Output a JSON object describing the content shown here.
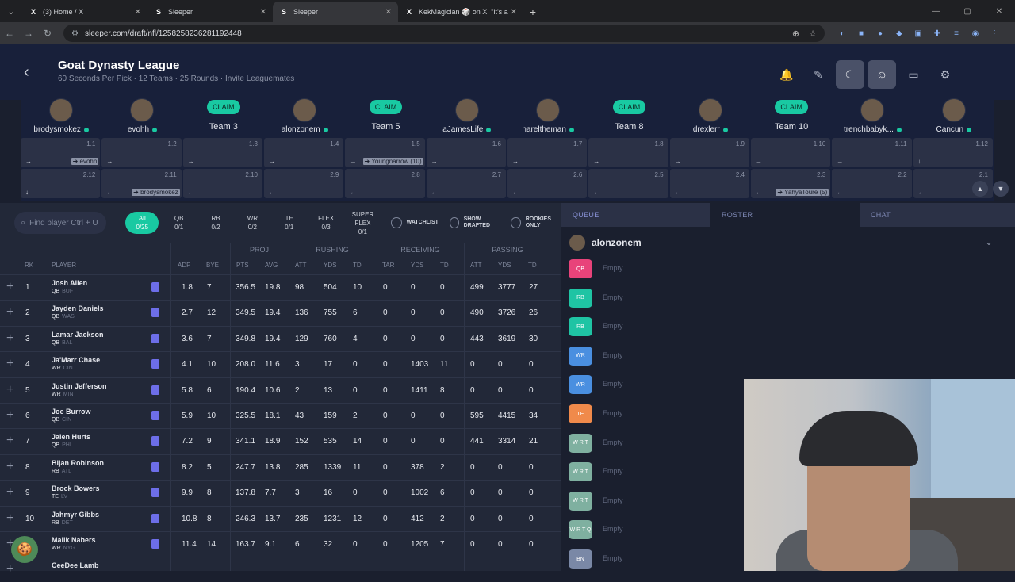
{
  "browser": {
    "tabs": [
      {
        "title": "(3) Home / X",
        "favicon": "X"
      },
      {
        "title": "Sleeper",
        "favicon": "S"
      },
      {
        "title": "Sleeper",
        "favicon": "S",
        "active": true
      },
      {
        "title": "KekMagician 🎲 on X: \"it's a",
        "favicon": "X"
      }
    ],
    "url": "sleeper.com/draft/nfl/1258258236281192448"
  },
  "header": {
    "league_name": "Goat Dynasty League",
    "league_sub": "60 Seconds Per Pick · 12 Teams · 25 Rounds · Invite Leaguemates"
  },
  "teams": [
    {
      "name": "brodysmokez",
      "claim": false,
      "online": true
    },
    {
      "name": "evohh",
      "claim": false,
      "online": true
    },
    {
      "name": "Team 3",
      "claim": true,
      "online": false
    },
    {
      "name": "alonzonem",
      "claim": false,
      "online": true
    },
    {
      "name": "Team 5",
      "claim": true,
      "online": false
    },
    {
      "name": "aJamesLife",
      "claim": false,
      "online": true
    },
    {
      "name": "hareltheman",
      "claim": false,
      "online": true
    },
    {
      "name": "Team 8",
      "claim": true,
      "online": false
    },
    {
      "name": "drexlerr",
      "claim": false,
      "online": true
    },
    {
      "name": "Team 10",
      "claim": true,
      "online": false
    },
    {
      "name": "trenchbabyk...",
      "claim": false,
      "online": true
    },
    {
      "name": "Cancun",
      "claim": false,
      "online": true
    }
  ],
  "claim_label": "CLAIM",
  "board": {
    "row1": [
      {
        "num": "1.1",
        "tag": "➔ evohh"
      },
      {
        "num": "1.2",
        "tag": ""
      },
      {
        "num": "1.3",
        "tag": ""
      },
      {
        "num": "1.4",
        "tag": ""
      },
      {
        "num": "1.5",
        "tag": "➔ Youngnarrow (10)"
      },
      {
        "num": "1.6",
        "tag": ""
      },
      {
        "num": "1.7",
        "tag": ""
      },
      {
        "num": "1.8",
        "tag": ""
      },
      {
        "num": "1.9",
        "tag": ""
      },
      {
        "num": "1.10",
        "tag": ""
      },
      {
        "num": "1.11",
        "tag": ""
      },
      {
        "num": "1.12",
        "tag": ""
      }
    ],
    "row2": [
      {
        "num": "2.12",
        "tag": ""
      },
      {
        "num": "2.11",
        "tag": "➔ brodysmokez"
      },
      {
        "num": "2.10",
        "tag": ""
      },
      {
        "num": "2.9",
        "tag": ""
      },
      {
        "num": "2.8",
        "tag": ""
      },
      {
        "num": "2.7",
        "tag": ""
      },
      {
        "num": "2.6",
        "tag": ""
      },
      {
        "num": "2.5",
        "tag": ""
      },
      {
        "num": "2.4",
        "tag": ""
      },
      {
        "num": "2.3",
        "tag": "➔ YahyaToure (5)"
      },
      {
        "num": "2.2",
        "tag": ""
      },
      {
        "num": "2.1",
        "tag": ""
      }
    ]
  },
  "filters": {
    "search_placeholder": "Find player Ctrl + U",
    "positions": [
      {
        "label": "All",
        "count": "0/25",
        "active": true
      },
      {
        "label": "QB",
        "count": "0/1"
      },
      {
        "label": "RB",
        "count": "0/2"
      },
      {
        "label": "WR",
        "count": "0/2"
      },
      {
        "label": "TE",
        "count": "0/1"
      },
      {
        "label": "FLEX",
        "count": "0/3"
      },
      {
        "label": "SUPER FLEX",
        "count": "0/1"
      }
    ],
    "watchlist": "WATCHLIST",
    "show_drafted": "SHOW DRAFTED",
    "rookies_only": "ROOKIES ONLY"
  },
  "table": {
    "groups": {
      "proj": "PROJ",
      "rushing": "RUSHING",
      "receiving": "RECEIVING",
      "passing": "PASSING"
    },
    "columns": {
      "rk": "RK",
      "player": "PLAYER",
      "adp": "ADP",
      "bye": "BYE",
      "pts": "PTS",
      "avg": "AVG",
      "att": "ATT",
      "yds": "YDS",
      "td": "TD",
      "tar": "TAR",
      "ryds": "YDS",
      "rtd": "TD",
      "patt": "ATT",
      "pyds": "YDS",
      "ptd": "TD"
    },
    "rows": [
      {
        "rk": "1",
        "name": "Josh Allen",
        "pos": "QB",
        "team": "BUF",
        "adp": "1.8",
        "bye": "7",
        "pts": "356.5",
        "avg": "19.8",
        "ratt": "98",
        "ryds": "504",
        "rtd": "10",
        "tar": "0",
        "recyds": "0",
        "rectd": "0",
        "patt": "499",
        "pyds": "3777",
        "ptd": "27"
      },
      {
        "rk": "2",
        "name": "Jayden Daniels",
        "pos": "QB",
        "team": "WAS",
        "adp": "2.7",
        "bye": "12",
        "pts": "349.5",
        "avg": "19.4",
        "ratt": "136",
        "ryds": "755",
        "rtd": "6",
        "tar": "0",
        "recyds": "0",
        "rectd": "0",
        "patt": "490",
        "pyds": "3726",
        "ptd": "26"
      },
      {
        "rk": "3",
        "name": "Lamar Jackson",
        "pos": "QB",
        "team": "BAL",
        "adp": "3.6",
        "bye": "7",
        "pts": "349.8",
        "avg": "19.4",
        "ratt": "129",
        "ryds": "760",
        "rtd": "4",
        "tar": "0",
        "recyds": "0",
        "rectd": "0",
        "patt": "443",
        "pyds": "3619",
        "ptd": "30"
      },
      {
        "rk": "4",
        "name": "Ja'Marr Chase",
        "pos": "WR",
        "team": "CIN",
        "adp": "4.1",
        "bye": "10",
        "pts": "208.0",
        "avg": "11.6",
        "ratt": "3",
        "ryds": "17",
        "rtd": "0",
        "tar": "0",
        "recyds": "1403",
        "rectd": "11",
        "patt": "0",
        "pyds": "0",
        "ptd": "0"
      },
      {
        "rk": "5",
        "name": "Justin Jefferson",
        "pos": "WR",
        "team": "MIN",
        "adp": "5.8",
        "bye": "6",
        "pts": "190.4",
        "avg": "10.6",
        "ratt": "2",
        "ryds": "13",
        "rtd": "0",
        "tar": "0",
        "recyds": "1411",
        "rectd": "8",
        "patt": "0",
        "pyds": "0",
        "ptd": "0"
      },
      {
        "rk": "6",
        "name": "Joe Burrow",
        "pos": "QB",
        "team": "CIN",
        "adp": "5.9",
        "bye": "10",
        "pts": "325.5",
        "avg": "18.1",
        "ratt": "43",
        "ryds": "159",
        "rtd": "2",
        "tar": "0",
        "recyds": "0",
        "rectd": "0",
        "patt": "595",
        "pyds": "4415",
        "ptd": "34"
      },
      {
        "rk": "7",
        "name": "Jalen Hurts",
        "pos": "QB",
        "team": "PHI",
        "adp": "7.2",
        "bye": "9",
        "pts": "341.1",
        "avg": "18.9",
        "ratt": "152",
        "ryds": "535",
        "rtd": "14",
        "tar": "0",
        "recyds": "0",
        "rectd": "0",
        "patt": "441",
        "pyds": "3314",
        "ptd": "21"
      },
      {
        "rk": "8",
        "name": "Bijan Robinson",
        "pos": "RB",
        "team": "ATL",
        "adp": "8.2",
        "bye": "5",
        "pts": "247.7",
        "avg": "13.8",
        "ratt": "285",
        "ryds": "1339",
        "rtd": "11",
        "tar": "0",
        "recyds": "378",
        "rectd": "2",
        "patt": "0",
        "pyds": "0",
        "ptd": "0"
      },
      {
        "rk": "9",
        "name": "Brock Bowers",
        "pos": "TE",
        "team": "LV",
        "adp": "9.9",
        "bye": "8",
        "pts": "137.8",
        "avg": "7.7",
        "ratt": "3",
        "ryds": "16",
        "rtd": "0",
        "tar": "0",
        "recyds": "1002",
        "rectd": "6",
        "patt": "0",
        "pyds": "0",
        "ptd": "0"
      },
      {
        "rk": "10",
        "name": "Jahmyr Gibbs",
        "pos": "RB",
        "team": "DET",
        "adp": "10.8",
        "bye": "8",
        "pts": "246.3",
        "avg": "13.7",
        "ratt": "235",
        "ryds": "1231",
        "rtd": "12",
        "tar": "0",
        "recyds": "412",
        "rectd": "2",
        "patt": "0",
        "pyds": "0",
        "ptd": "0"
      },
      {
        "rk": "11",
        "name": "Malik Nabers",
        "pos": "WR",
        "team": "NYG",
        "adp": "11.4",
        "bye": "14",
        "pts": "163.7",
        "avg": "9.1",
        "ratt": "6",
        "ryds": "32",
        "rtd": "0",
        "tar": "0",
        "recyds": "1205",
        "rectd": "7",
        "patt": "0",
        "pyds": "0",
        "ptd": "0"
      },
      {
        "rk": "",
        "name": "CeeDee Lamb",
        "pos": "",
        "team": "",
        "adp": "",
        "bye": "",
        "pts": "",
        "avg": "",
        "ratt": "",
        "ryds": "",
        "rtd": "",
        "tar": "",
        "recyds": "",
        "rectd": "",
        "patt": "",
        "pyds": "",
        "ptd": ""
      }
    ]
  },
  "right_panel": {
    "tabs": {
      "queue": "QUEUE",
      "roster": "ROSTER",
      "chat": "CHAT"
    },
    "owner": "alonzonem",
    "empty_label": "Empty",
    "slots": [
      {
        "label": "QB",
        "color": "#e8437a"
      },
      {
        "label": "RB",
        "color": "#1fc4a4"
      },
      {
        "label": "RB",
        "color": "#1fc4a4"
      },
      {
        "label": "WR",
        "color": "#4a8fe0"
      },
      {
        "label": "WR",
        "color": "#4a8fe0"
      },
      {
        "label": "TE",
        "color": "#f08a4b"
      },
      {
        "label": "W R T",
        "color": "#7fb0a0"
      },
      {
        "label": "W R T",
        "color": "#7fb0a0"
      },
      {
        "label": "W R T",
        "color": "#7fb0a0"
      },
      {
        "label": "W R T Q",
        "color": "#7fb0a0"
      },
      {
        "label": "BN",
        "color": "#7a88a6"
      }
    ]
  },
  "colors": {
    "accent": "#19c9a2",
    "background": "#1a1f2e",
    "panel": "#222838"
  }
}
